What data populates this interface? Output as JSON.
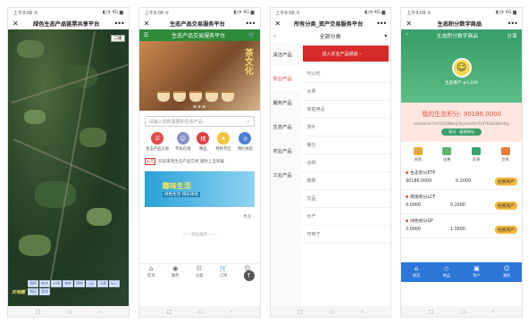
{
  "phone1": {
    "status": {
      "left": "上午9:08 ⑤",
      "right": "◧◔ 4G ▆"
    },
    "title": "绿色生态产品链票共享平台",
    "zoom": "二维",
    "logo": "天地图",
    "legend": [
      "图例",
      "地块",
      "水域",
      "林地",
      "耕地",
      "山区",
      "交通",
      "标记",
      "图层",
      "管理"
    ]
  },
  "phone2": {
    "status": {
      "left": "上午9:08 ⑤",
      "right": "◧◔ 4G ▆"
    },
    "title": "生态产品交易服务平台",
    "green_title": "生态产品交易服务平台",
    "banner_brand": "茶文化",
    "search_placeholder": "请输入您所需要的生态产品",
    "cats": [
      {
        "label": "生态产品交易",
        "color": "#e24b4b",
        "glyph": "☰"
      },
      {
        "label": "专家在线",
        "color": "#8a92c9",
        "glyph": "☺"
      },
      {
        "label": "精品",
        "color": "#e23e3e",
        "glyph": "精"
      },
      {
        "label": "特色专区",
        "color": "#f3c23a",
        "glyph": "★"
      },
      {
        "label": "预约体验",
        "color": "#4a7fd0",
        "glyph": "◎"
      }
    ],
    "notice_tag": "公告",
    "notice_text": "欢迎来到生态产品交易 谨防上当受骗",
    "ad_title": "趣味生活",
    "ad_sub": "绿色生活 快乐体验",
    "more": "更多 ›",
    "separator": "—— 精品推荐 ——",
    "tabs": [
      {
        "label": "首页",
        "glyph": "⌂"
      },
      {
        "label": "服务",
        "glyph": "◉"
      },
      {
        "label": "分类",
        "glyph": "☷"
      },
      {
        "label": "订单",
        "glyph": "🛒"
      },
      {
        "label": "我的",
        "glyph": "☺"
      }
    ]
  },
  "phone3": {
    "status": {
      "left": "上午9:08 ⑤",
      "right": "◧◔ 4G ▆"
    },
    "title": "所有分类_资产交易服务平台",
    "header": "全部分类",
    "left_items": [
      "清洁产品",
      "农业产品",
      "服务产品",
      "生态产品",
      "农业产品",
      "工业产品"
    ],
    "active_index": 1,
    "red_button": "进入农业产品频道 ›",
    "sub_items": [
      "可以吃",
      "水果",
      "家庭用品",
      "茶叶",
      "粮仓",
      "谷物",
      "蔬菜",
      "饮品",
      "水产",
      "可用于"
    ]
  },
  "phone4": {
    "status": {
      "left": "上午9:08 ⑤",
      "right": "◧◔ 4G ▆"
    },
    "title": "生态积分数字商品",
    "green_title": "生态积分数字商品",
    "green_right": "分享",
    "username": "生态用户  ★1,000",
    "score_label": "我的生态积分: 90186.0000",
    "address": "ecomsh1c7ieYz2h3NkmJ3hyrmaYsh7h3TK4k2d0mfxp",
    "score_btn": "积分 · 复制地址",
    "icons": [
      {
        "label": "采购",
        "color": "#e7a93b"
      },
      {
        "label": "出售",
        "color": "#5bb56b"
      },
      {
        "label": "资源",
        "color": "#3aa06a"
      },
      {
        "label": "交易",
        "color": "#e97c3b"
      }
    ],
    "assets": [
      {
        "name": "生态积分ETP",
        "a": "90186.0000",
        "b": "0.2000",
        "btn": "兑换资产"
      },
      {
        "name": "碳排积分LCF",
        "a": "0.0000",
        "b": "0.2000",
        "btn": "兑换资产"
      },
      {
        "name": "绿色积分GF",
        "a": "0.0000",
        "b": "1.0000",
        "btn": "兑换资产"
      }
    ],
    "tabs": [
      {
        "label": "首页",
        "glyph": "⌂"
      },
      {
        "label": "商品",
        "glyph": "◇"
      },
      {
        "label": "资产",
        "glyph": "▣"
      },
      {
        "label": "我的",
        "glyph": "☺"
      }
    ]
  },
  "nav": {
    "back": "‹",
    "home": "○",
    "recent": "□"
  }
}
